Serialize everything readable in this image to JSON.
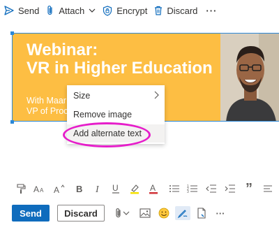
{
  "toolbar": {
    "send_label": "Send",
    "attach_label": "Attach",
    "encrypt_label": "Encrypt",
    "discard_label": "Discard",
    "more_label": "···"
  },
  "banner": {
    "title_line1": "Webinar:",
    "title_line2": "VR in Higher Education",
    "subtitle_line1": "With Maar",
    "subtitle_line2": "VP of Proc"
  },
  "context_menu": {
    "items": [
      {
        "label": "Size"
      },
      {
        "label": "Remove image"
      },
      {
        "label": "Add alternate text"
      }
    ]
  },
  "format_toolbar": {
    "quote_glyph": "”"
  },
  "actions": {
    "send_label": "Send",
    "discard_label": "Discard",
    "more_label": "···"
  },
  "colors": {
    "accent": "#0f6cbd",
    "banner_bg": "#fdbe43",
    "highlight": "#e61dca"
  }
}
